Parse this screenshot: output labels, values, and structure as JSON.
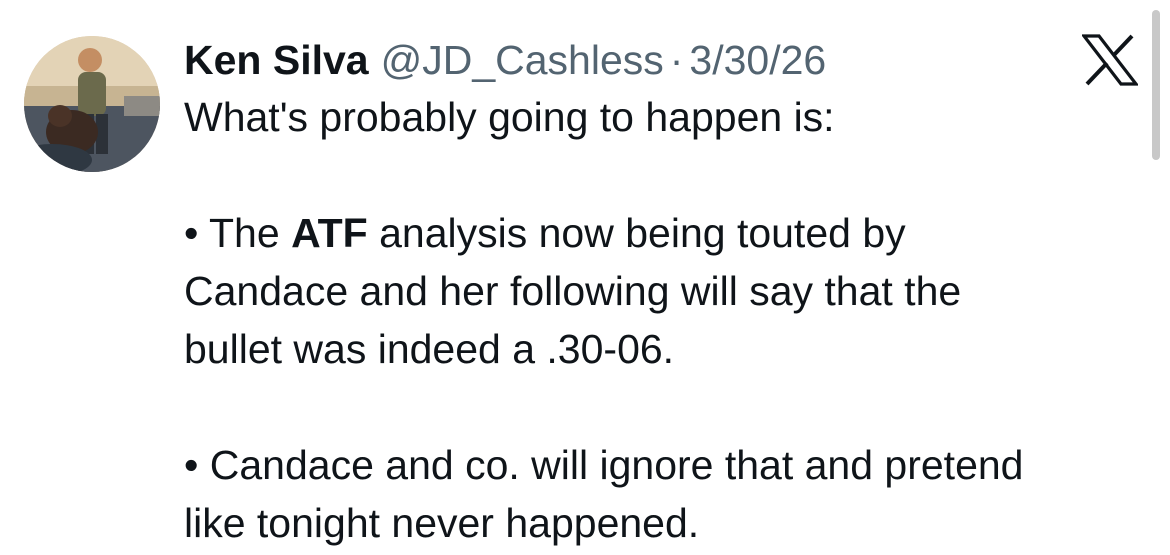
{
  "tweet": {
    "author": {
      "display_name": "Ken Silva",
      "handle": "@JD_Cashless",
      "separator": "·",
      "date": "3/30/26"
    },
    "text": {
      "intro": "What's probably going to happen is:",
      "bullet1": {
        "bullet": "•",
        "pre": "The ",
        "bold": "ATF",
        "post_line1": " analysis now being touted by",
        "line2": "Candace and her following will say that the",
        "line3": "bullet was indeed a .30-06."
      },
      "bullet2": {
        "bullet": "•",
        "line1": "Candace and co. will ignore that and pretend",
        "line2": "like tonight never happened."
      }
    },
    "icons": {
      "brand": "x-logo-icon",
      "avatar": "avatar-photo"
    }
  },
  "colors": {
    "text_primary": "#0f1419",
    "text_secondary": "#536471",
    "background": "#ffffff"
  }
}
